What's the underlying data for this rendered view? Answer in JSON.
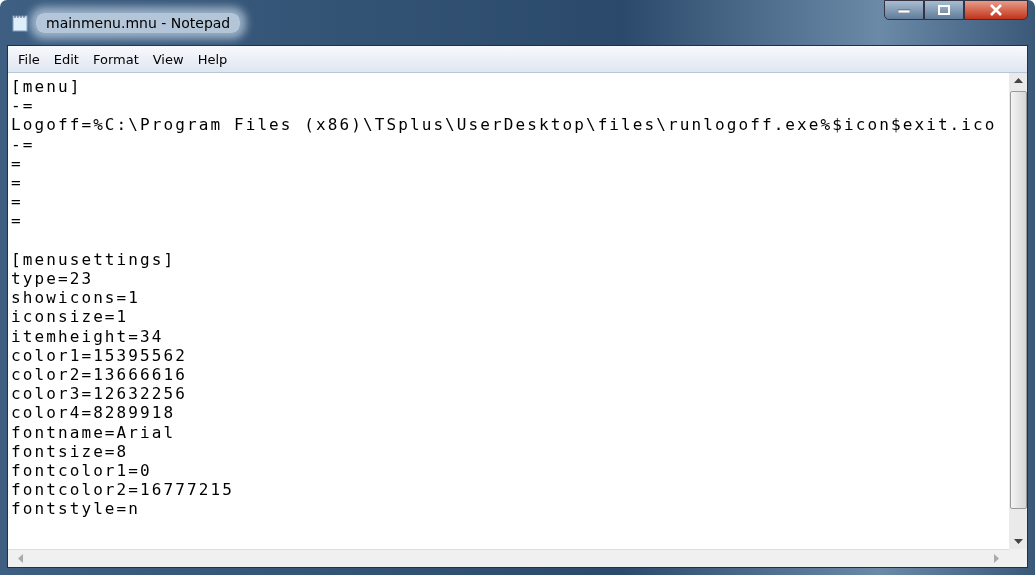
{
  "window": {
    "title": "mainmenu.mnu - Notepad"
  },
  "menu": [
    "File",
    "Edit",
    "Format",
    "View",
    "Help"
  ],
  "editor": {
    "sections": [
      {
        "lines": [
          "[menu]",
          "-=",
          "Logoff=%C:\\Program Files (x86)\\TSplus\\UserDesktop\\files\\runlogoff.exe%$icon$exit.ico",
          "-=",
          "=",
          "=",
          "=",
          "="
        ]
      },
      {
        "lines": [
          "[menusettings]",
          "type=23",
          "showicons=1",
          "iconsize=1",
          "itemheight=34",
          "color1=15395562",
          "color2=13666616",
          "color3=12632256",
          "color4=8289918",
          "fontname=Arial",
          "fontsize=8",
          "fontcolor1=0",
          "fontcolor2=16777215",
          "fontstyle=n"
        ]
      }
    ]
  }
}
